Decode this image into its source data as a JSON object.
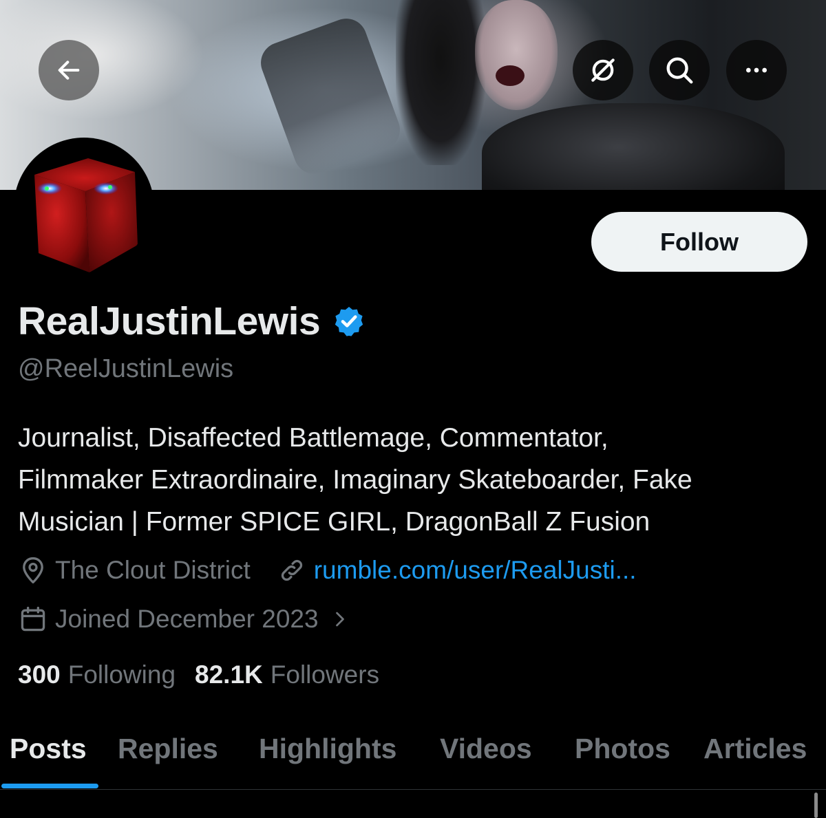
{
  "header": {
    "back_icon": "arrow-left-icon",
    "grok_icon": "grok-icon",
    "search_icon": "search-icon",
    "more_icon": "more-horizontal-icon"
  },
  "profile": {
    "display_name": "RealJustinLewis",
    "verified": true,
    "verified_color": "#1d9bf0",
    "handle": "@ReelJustinLewis",
    "follow_label": "Follow",
    "bio_lines": [
      "Journalist, Disaffected Battlemage, Commentator,",
      "Filmmaker Extraordinaire, Imaginary Skateboarder, Fake",
      "Musician | Former SPICE GIRL, DragonBall Z Fusion"
    ],
    "location": "The Clout District",
    "website": "rumble.com/user/RealJusti...",
    "joined": "Joined December 2023",
    "following_count": "300",
    "following_label": "Following",
    "followers_count": "82.1K",
    "followers_label": "Followers"
  },
  "tabs": [
    {
      "label": "Posts",
      "active": true
    },
    {
      "label": "Replies",
      "active": false
    },
    {
      "label": "Highlights",
      "active": false
    },
    {
      "label": "Videos",
      "active": false
    },
    {
      "label": "Photos",
      "active": false
    },
    {
      "label": "Articles",
      "active": false
    }
  ],
  "colors": {
    "background": "#000000",
    "text_primary": "#e7e9ea",
    "text_secondary": "#71767b",
    "accent": "#1d9bf0",
    "follow_button_bg": "#eff3f4"
  }
}
